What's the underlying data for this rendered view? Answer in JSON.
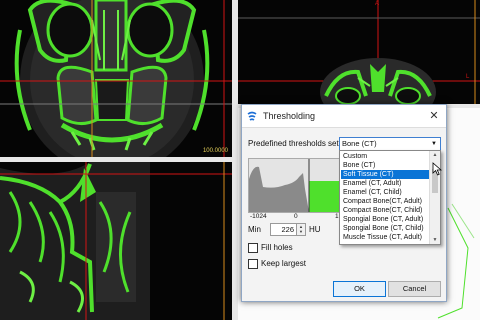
{
  "viewports": {
    "top_right_marker": "A",
    "right_marker": "L",
    "scale_readout": "100.0000"
  },
  "dialog": {
    "title": "Thresholding",
    "predefined_label": "Predefined thresholds sets:",
    "selected_set": "Bone (CT)",
    "options": [
      "Custom",
      "Bone (CT)",
      "Soft Tissue (CT)",
      "Enamel (CT, Adult)",
      "Enamel (CT, Child)",
      "Compact Bone(CT, Adult)",
      "Compact Bone(CT, Child)",
      "Spongial Bone (CT, Adult)",
      "Spongial Bone (CT, Child)",
      "Muscle Tissue (CT, Adult)"
    ],
    "highlighted_option": "Soft Tissue (CT)",
    "histogram_ticks": [
      "-1024",
      "0",
      "1"
    ],
    "min_label": "Min",
    "min_value": "226",
    "unit": "HU",
    "fill_holes_label": "Fill holes",
    "keep_largest_label": "Keep largest",
    "ok_label": "OK",
    "cancel_label": "Cancel"
  },
  "colors": {
    "bone_overlay": "#4fe02c",
    "selection": "#0a74d6",
    "crosshair_red": "#d11414",
    "crosshair_orange": "#d88a1c"
  }
}
